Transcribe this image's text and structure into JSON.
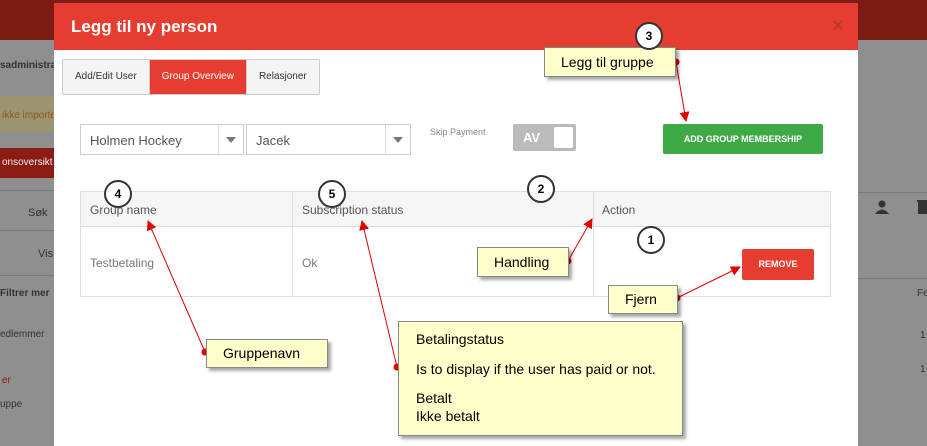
{
  "background": {
    "left_texts": [
      "sadministras",
      "ikke importe",
      "onsoversikt",
      "Søk",
      "Vis",
      "Filtrer mer",
      "edlemmer",
      "er",
      "uppe"
    ],
    "right_texts": [
      "Fe",
      "1",
      "1"
    ]
  },
  "modal": {
    "title": "Legg til ny person",
    "close_icon": "×"
  },
  "tabs": [
    {
      "label": "Add/Edit User",
      "active": false
    },
    {
      "label": "Group Overview",
      "active": true
    },
    {
      "label": "Relasjoner",
      "active": false
    }
  ],
  "filters": {
    "club": "Holmen Hockey",
    "person": "Jacek",
    "skip_payment_label": "Skip Payment",
    "skip_payment_toggle": "AV"
  },
  "add_button": "ADD GROUP MEMBERSHIP",
  "table": {
    "headers": [
      "Group name",
      "Subscription status",
      "Action"
    ],
    "rows": [
      {
        "group": "Testbetaling",
        "status": "Ok",
        "action": "REMOVE"
      }
    ]
  },
  "annotations": {
    "callouts": {
      "legg_til": "Legg til gruppe",
      "handling": "Handling",
      "fjern": "Fjern",
      "gruppenavn": "Gruppenavn",
      "betaling_title": "Betalingstatus",
      "betaling_desc": "Is to display if the user has paid or not.",
      "betalt": "Betalt",
      "ikke_betalt": "Ikke betalt"
    },
    "badges": [
      "1",
      "2",
      "3",
      "4",
      "5"
    ]
  },
  "colors": {
    "header_red": "#e53e30",
    "green": "#3fa847",
    "callout_bg": "#ffffcc",
    "arrow": "#e00000"
  }
}
